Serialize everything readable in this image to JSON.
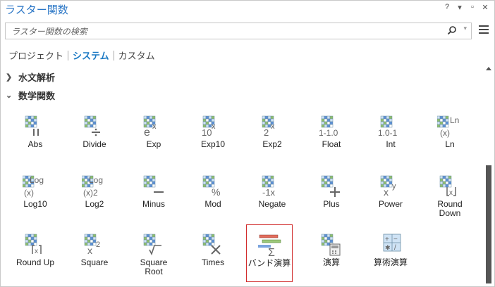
{
  "window": {
    "title": "ラスター関数",
    "buttons": [
      "?",
      "▾",
      "▫",
      "✕"
    ]
  },
  "search": {
    "placeholder": "ラスター関数の検索",
    "value": ""
  },
  "tabs": [
    {
      "label": "プロジェクト",
      "active": false
    },
    {
      "label": "システム",
      "active": true
    },
    {
      "label": "カスタム",
      "active": false
    }
  ],
  "groups": [
    {
      "label": "水文解析",
      "expanded": false
    },
    {
      "label": "数学関数",
      "expanded": true
    }
  ],
  "tools": [
    {
      "label": "Abs",
      "icon": "abs-icon"
    },
    {
      "label": "Divide",
      "icon": "divide-icon"
    },
    {
      "label": "Exp",
      "icon": "exp-icon"
    },
    {
      "label": "Exp10",
      "icon": "exp10-icon"
    },
    {
      "label": "Exp2",
      "icon": "exp2-icon"
    },
    {
      "label": "Float",
      "icon": "float-icon"
    },
    {
      "label": "Int",
      "icon": "int-icon"
    },
    {
      "label": "Ln",
      "icon": "ln-icon"
    },
    {
      "label": "Log10",
      "icon": "log10-icon"
    },
    {
      "label": "Log2",
      "icon": "log2-icon"
    },
    {
      "label": "Minus",
      "icon": "minus-icon"
    },
    {
      "label": "Mod",
      "icon": "mod-icon"
    },
    {
      "label": "Negate",
      "icon": "negate-icon"
    },
    {
      "label": "Plus",
      "icon": "plus-icon"
    },
    {
      "label": "Power",
      "icon": "power-icon"
    },
    {
      "label": "Round Down",
      "icon": "round-down-icon"
    },
    {
      "label": "Round Up",
      "icon": "round-up-icon"
    },
    {
      "label": "Square",
      "icon": "square-icon"
    },
    {
      "label": "Square Root",
      "icon": "square-root-icon"
    },
    {
      "label": "Times",
      "icon": "times-icon"
    },
    {
      "label": "バンド演算",
      "icon": "band-arithmetic-icon",
      "selected": true
    },
    {
      "label": "演算",
      "icon": "arithmetic-icon"
    },
    {
      "label": "算術演算",
      "icon": "math-operators-icon"
    }
  ],
  "colors": {
    "accent": "#1c7ac4",
    "title": "#2a76c6",
    "selection": "#d12b2b",
    "grid_green": "#8fbf6a",
    "grid_blue": "#5b8fd6"
  }
}
